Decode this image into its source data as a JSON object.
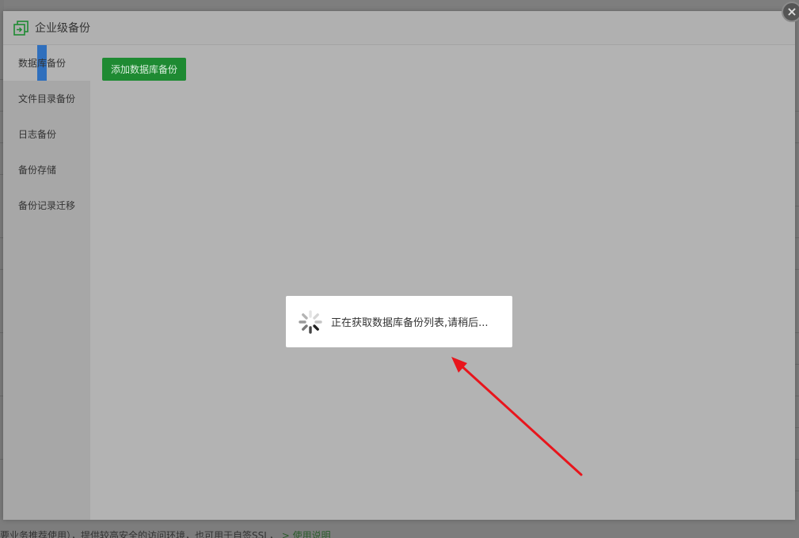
{
  "dialog": {
    "title": "企业级备份",
    "close_symbol": "×",
    "header_icon": "backup-window-icon"
  },
  "sidebar": {
    "items": [
      {
        "label": "数据库备份",
        "active": true
      },
      {
        "label": "文件目录备份",
        "active": false
      },
      {
        "label": "日志备份",
        "active": false
      },
      {
        "label": "备份存储",
        "active": false
      },
      {
        "label": "备份记录迁移",
        "active": false
      }
    ]
  },
  "main": {
    "add_button_label": "添加数据库备份"
  },
  "loading": {
    "message": "正在获取数据库备份列表,请稍后..."
  },
  "background": {
    "footer_text": "要业务推荐使用），提供较高安全的访问环境，也可用于自签SSL，",
    "footer_link": "> 使用说明"
  },
  "colors": {
    "accent_green": "#1e8a32",
    "active_marker": "#2f6fbd",
    "arrow": "#e8151c",
    "overlay": "#b3b3b3"
  }
}
